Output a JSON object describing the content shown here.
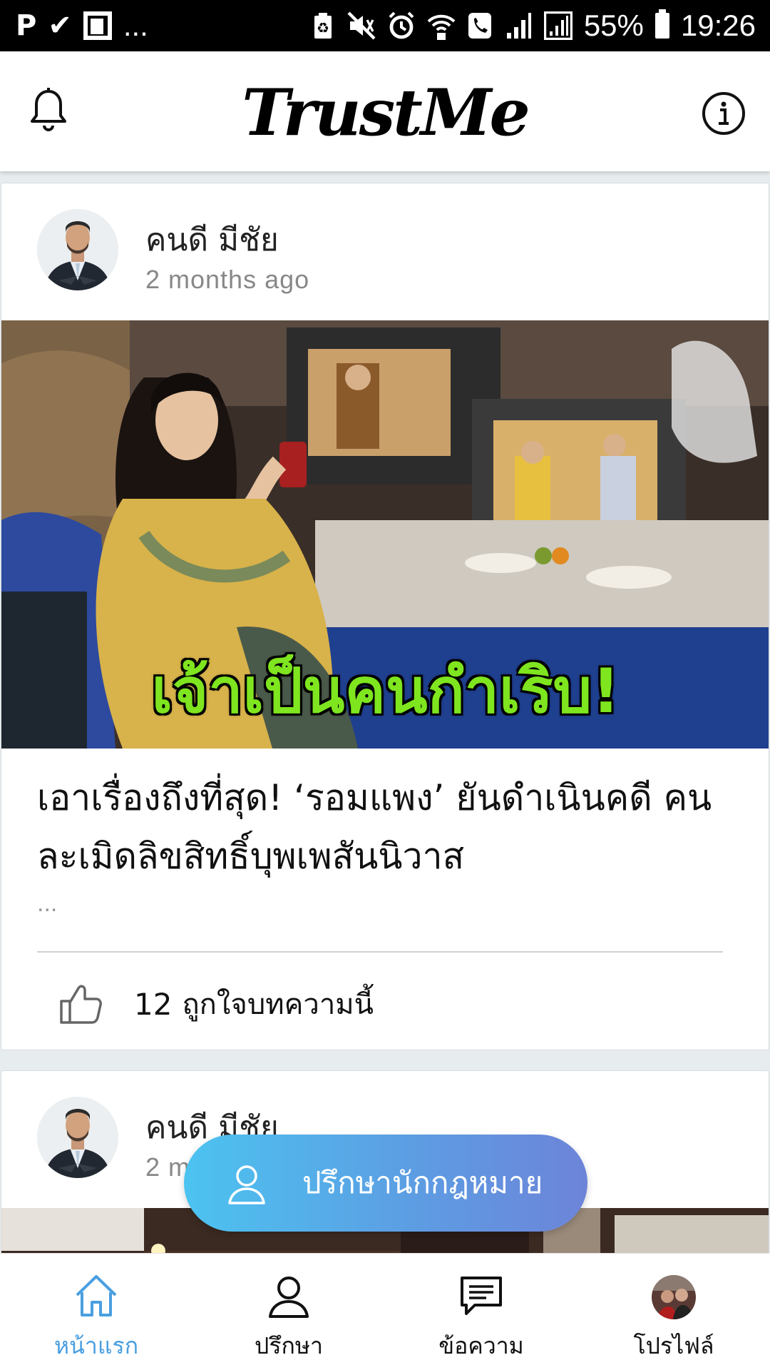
{
  "status_bar": {
    "left_icons": [
      "parking-icon",
      "flipboard-check-icon",
      "flipboard-icon",
      "more-notifications-icon"
    ],
    "more": "...",
    "right_icons": [
      "battery-saver-icon",
      "mute-icon",
      "alarm-icon",
      "wifi-calling-icon",
      "phone-icon",
      "signal-icon",
      "signal-icon"
    ],
    "battery": "55%",
    "time": "19:26"
  },
  "header": {
    "logo": "TrustMe",
    "left_icon": "bell-icon",
    "right_icon": "info-icon"
  },
  "posts": [
    {
      "author": "คนดี มีชัย",
      "time": "2 months ago",
      "image_caption": "เจ้าเป็นคนกำเริบ!",
      "title": "เอาเรื่องถึงที่สุด! ‘รอมแพง’ ยันดำเนินคดี คนละเมิดลิขสิทธิ์บุพเพสันนิวาส",
      "excerpt": "...",
      "like_count": "12",
      "like_label": "ถูกใจบทความนี้"
    },
    {
      "author": "คนดี มีชัย",
      "time": "2 m"
    }
  ],
  "consult_button": {
    "label": "ปรึกษานักกฎหมาย",
    "icon": "user-icon"
  },
  "bottom_nav": [
    {
      "label": "หน้าแรก",
      "icon": "home-icon",
      "active": true
    },
    {
      "label": "ปรึกษา",
      "icon": "user-icon",
      "active": false
    },
    {
      "label": "ข้อความ",
      "icon": "message-icon",
      "active": false
    },
    {
      "label": "โปรไฟล์",
      "icon": "profile-avatar",
      "active": false
    }
  ],
  "colors": {
    "accent": "#4a9fe0",
    "gradient_start": "#4cc3f0",
    "gradient_end": "#6d84d8",
    "caption_green": "#7ee51f",
    "background": "#e7ecef"
  }
}
